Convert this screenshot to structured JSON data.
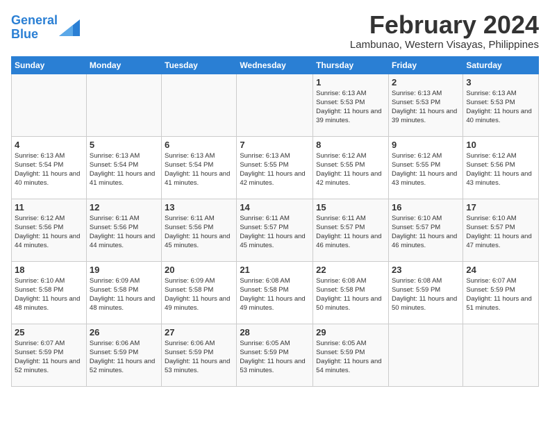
{
  "logo": {
    "line1": "General",
    "line2": "Blue"
  },
  "title": "February 2024",
  "subtitle": "Lambunao, Western Visayas, Philippines",
  "days_of_week": [
    "Sunday",
    "Monday",
    "Tuesday",
    "Wednesday",
    "Thursday",
    "Friday",
    "Saturday"
  ],
  "weeks": [
    [
      {
        "day": "",
        "info": ""
      },
      {
        "day": "",
        "info": ""
      },
      {
        "day": "",
        "info": ""
      },
      {
        "day": "",
        "info": ""
      },
      {
        "day": "1",
        "info": "Sunrise: 6:13 AM\nSunset: 5:53 PM\nDaylight: 11 hours and 39 minutes."
      },
      {
        "day": "2",
        "info": "Sunrise: 6:13 AM\nSunset: 5:53 PM\nDaylight: 11 hours and 39 minutes."
      },
      {
        "day": "3",
        "info": "Sunrise: 6:13 AM\nSunset: 5:53 PM\nDaylight: 11 hours and 40 minutes."
      }
    ],
    [
      {
        "day": "4",
        "info": "Sunrise: 6:13 AM\nSunset: 5:54 PM\nDaylight: 11 hours and 40 minutes."
      },
      {
        "day": "5",
        "info": "Sunrise: 6:13 AM\nSunset: 5:54 PM\nDaylight: 11 hours and 41 minutes."
      },
      {
        "day": "6",
        "info": "Sunrise: 6:13 AM\nSunset: 5:54 PM\nDaylight: 11 hours and 41 minutes."
      },
      {
        "day": "7",
        "info": "Sunrise: 6:13 AM\nSunset: 5:55 PM\nDaylight: 11 hours and 42 minutes."
      },
      {
        "day": "8",
        "info": "Sunrise: 6:12 AM\nSunset: 5:55 PM\nDaylight: 11 hours and 42 minutes."
      },
      {
        "day": "9",
        "info": "Sunrise: 6:12 AM\nSunset: 5:55 PM\nDaylight: 11 hours and 43 minutes."
      },
      {
        "day": "10",
        "info": "Sunrise: 6:12 AM\nSunset: 5:56 PM\nDaylight: 11 hours and 43 minutes."
      }
    ],
    [
      {
        "day": "11",
        "info": "Sunrise: 6:12 AM\nSunset: 5:56 PM\nDaylight: 11 hours and 44 minutes."
      },
      {
        "day": "12",
        "info": "Sunrise: 6:11 AM\nSunset: 5:56 PM\nDaylight: 11 hours and 44 minutes."
      },
      {
        "day": "13",
        "info": "Sunrise: 6:11 AM\nSunset: 5:56 PM\nDaylight: 11 hours and 45 minutes."
      },
      {
        "day": "14",
        "info": "Sunrise: 6:11 AM\nSunset: 5:57 PM\nDaylight: 11 hours and 45 minutes."
      },
      {
        "day": "15",
        "info": "Sunrise: 6:11 AM\nSunset: 5:57 PM\nDaylight: 11 hours and 46 minutes."
      },
      {
        "day": "16",
        "info": "Sunrise: 6:10 AM\nSunset: 5:57 PM\nDaylight: 11 hours and 46 minutes."
      },
      {
        "day": "17",
        "info": "Sunrise: 6:10 AM\nSunset: 5:57 PM\nDaylight: 11 hours and 47 minutes."
      }
    ],
    [
      {
        "day": "18",
        "info": "Sunrise: 6:10 AM\nSunset: 5:58 PM\nDaylight: 11 hours and 48 minutes."
      },
      {
        "day": "19",
        "info": "Sunrise: 6:09 AM\nSunset: 5:58 PM\nDaylight: 11 hours and 48 minutes."
      },
      {
        "day": "20",
        "info": "Sunrise: 6:09 AM\nSunset: 5:58 PM\nDaylight: 11 hours and 49 minutes."
      },
      {
        "day": "21",
        "info": "Sunrise: 6:08 AM\nSunset: 5:58 PM\nDaylight: 11 hours and 49 minutes."
      },
      {
        "day": "22",
        "info": "Sunrise: 6:08 AM\nSunset: 5:58 PM\nDaylight: 11 hours and 50 minutes."
      },
      {
        "day": "23",
        "info": "Sunrise: 6:08 AM\nSunset: 5:59 PM\nDaylight: 11 hours and 50 minutes."
      },
      {
        "day": "24",
        "info": "Sunrise: 6:07 AM\nSunset: 5:59 PM\nDaylight: 11 hours and 51 minutes."
      }
    ],
    [
      {
        "day": "25",
        "info": "Sunrise: 6:07 AM\nSunset: 5:59 PM\nDaylight: 11 hours and 52 minutes."
      },
      {
        "day": "26",
        "info": "Sunrise: 6:06 AM\nSunset: 5:59 PM\nDaylight: 11 hours and 52 minutes."
      },
      {
        "day": "27",
        "info": "Sunrise: 6:06 AM\nSunset: 5:59 PM\nDaylight: 11 hours and 53 minutes."
      },
      {
        "day": "28",
        "info": "Sunrise: 6:05 AM\nSunset: 5:59 PM\nDaylight: 11 hours and 53 minutes."
      },
      {
        "day": "29",
        "info": "Sunrise: 6:05 AM\nSunset: 5:59 PM\nDaylight: 11 hours and 54 minutes."
      },
      {
        "day": "",
        "info": ""
      },
      {
        "day": "",
        "info": ""
      }
    ]
  ]
}
